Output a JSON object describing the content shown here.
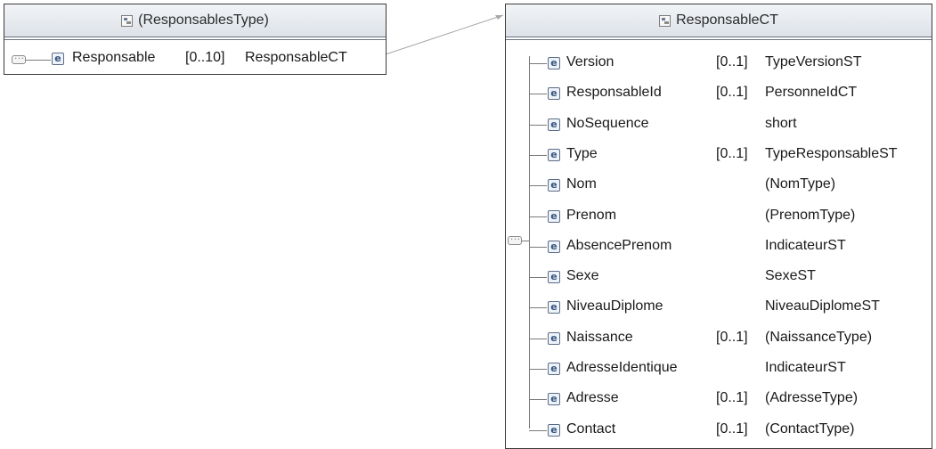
{
  "left_box": {
    "title": "(ResponsablesType)",
    "icon": "complex-type-icon",
    "element": {
      "name": "Responsable",
      "cardinality": "[0..10]",
      "type": "ResponsableCT"
    }
  },
  "right_box": {
    "title": "ResponsableCT",
    "icon": "complex-type-icon",
    "rows": [
      {
        "name": "Version",
        "cardinality": "[0..1]",
        "type": "TypeVersionST"
      },
      {
        "name": "ResponsableId",
        "cardinality": "[0..1]",
        "type": "PersonneIdCT"
      },
      {
        "name": "NoSequence",
        "cardinality": "",
        "type": "short"
      },
      {
        "name": "Type",
        "cardinality": "[0..1]",
        "type": "TypeResponsableST"
      },
      {
        "name": "Nom",
        "cardinality": "",
        "type": "(NomType)"
      },
      {
        "name": "Prenom",
        "cardinality": "",
        "type": "(PrenomType)"
      },
      {
        "name": "AbsencePrenom",
        "cardinality": "",
        "type": "IndicateurST"
      },
      {
        "name": "Sexe",
        "cardinality": "",
        "type": "SexeST"
      },
      {
        "name": "NiveauDiplome",
        "cardinality": "",
        "type": "NiveauDiplomeST"
      },
      {
        "name": "Naissance",
        "cardinality": "[0..1]",
        "type": "(NaissanceType)"
      },
      {
        "name": "AdresseIdentique",
        "cardinality": "",
        "type": "IndicateurST"
      },
      {
        "name": "Adresse",
        "cardinality": "[0..1]",
        "type": "(AdresseType)"
      },
      {
        "name": "Contact",
        "cardinality": "[0..1]",
        "type": "(ContactType)"
      }
    ]
  },
  "element_icon_glyph": "e",
  "sequence_icon_glyph": "···"
}
